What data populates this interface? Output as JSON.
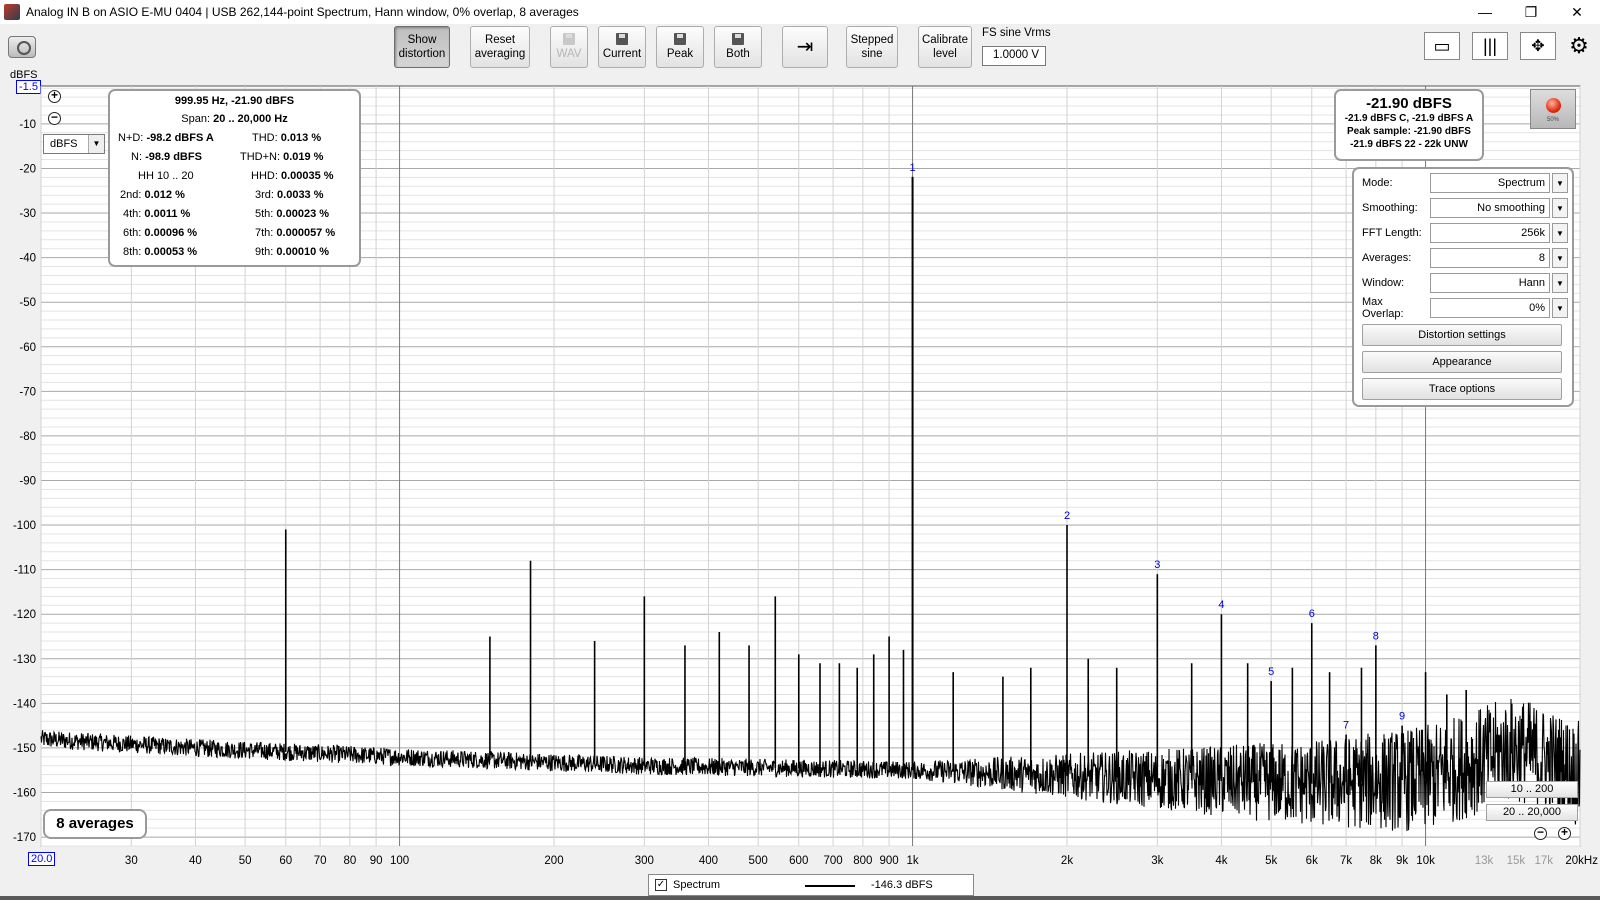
{
  "window": {
    "title": "Analog IN B on ASIO E-MU 0404 | USB 262,144-point Spectrum, Hann window, 0% overlap, 8 averages",
    "controls": [
      "—",
      "❐",
      "✕"
    ]
  },
  "toolbar": {
    "show_distortion": [
      "Show",
      "distortion"
    ],
    "reset_averaging": [
      "Reset",
      "averaging"
    ],
    "wav": "WAV",
    "current": "Current",
    "peak": "Peak",
    "both": "Both",
    "stepped_sine": [
      "Stepped",
      "sine"
    ],
    "calibrate_level": [
      "Calibrate",
      "level"
    ],
    "fs_sine_label": "FS sine Vrms",
    "fs_sine_value": "1.0000 V"
  },
  "axis": {
    "unit_label": "dBFS",
    "top_value_box": "-1.5",
    "left_value_box": "20.0",
    "unit_selected": "dBFS"
  },
  "distortion": {
    "header": "999.95 Hz, -21.90 dBFS",
    "span_label": "Span:",
    "span_value": "20 .. 20,000 Hz",
    "nd_label": "N+D:",
    "nd_value": "-98.2 dBFS A",
    "thd_label": "THD:",
    "thd_value": "0.013 %",
    "n_label": "N:",
    "n_value": "-98.9 dBFS",
    "thdn_label": "THD+N:",
    "thdn_value": "0.019 %",
    "hh_label": "HH 10 .. 20",
    "hhd_label": "HHD:",
    "hhd_value": "0.00035 %",
    "h2_label": "2nd:",
    "h2_value": "0.012 %",
    "h3_label": "3rd:",
    "h3_value": "0.0033 %",
    "h4_label": "4th:",
    "h4_value": "0.0011 %",
    "h5_label": "5th:",
    "h5_value": "0.00023 %",
    "h6_label": "6th:",
    "h6_value": "0.00096 %",
    "h7_label": "7th:",
    "h7_value": "0.000057 %",
    "h8_label": "8th:",
    "h8_value": "0.00053 %",
    "h9_label": "9th:",
    "h9_value": "0.00010 %"
  },
  "level": {
    "main": "-21.90 dBFS",
    "line1": "-21.9 dBFS C, -21.9 dBFS A",
    "line2": "Peak sample: -21.90 dBFS",
    "line3": "-21.9 dBFS 22 - 22k UNW",
    "record_pct": "50%"
  },
  "settings": {
    "mode_label": "Mode:",
    "mode_value": "Spectrum",
    "smoothing_label": "Smoothing:",
    "smoothing_value": "No  smoothing",
    "fft_label": "FFT Length:",
    "fft_value": "256k",
    "averages_label": "Averages:",
    "averages_value": "8",
    "window_label": "Window:",
    "window_value": "Hann",
    "overlap_label": "Max Overlap:",
    "overlap_value": "0%",
    "distortion_settings": "Distortion settings",
    "appearance": "Appearance",
    "trace_options": "Trace options"
  },
  "averages_badge": "8 averages",
  "range_buttons": [
    "10 .. 200",
    "20 .. 20,000"
  ],
  "legend": {
    "checked": "✓",
    "name": "Spectrum",
    "value": "-146.3 dBFS"
  },
  "colors": {
    "trace": "#000000",
    "grid_minor": "#e3e3e3",
    "grid_major": "#a8a8a8",
    "harmonic_label": "#0000cc",
    "value_box": "#0000ff"
  },
  "chart_data": {
    "type": "line",
    "title": "",
    "xlabel": "",
    "ylabel": "dBFS",
    "x_scale": "log",
    "xlim": [
      20,
      20000
    ],
    "ylim": [
      -172,
      -1.5
    ],
    "grid": true,
    "x_tick_values": [
      30,
      40,
      50,
      60,
      70,
      80,
      90,
      100,
      200,
      300,
      400,
      500,
      600,
      700,
      800,
      900,
      1000,
      2000,
      3000,
      4000,
      5000,
      6000,
      7000,
      8000,
      9000,
      10000,
      13000,
      15000,
      17000,
      20000
    ],
    "x_tick_labels": [
      "30",
      "40",
      "50",
      "60",
      "70",
      "80",
      "90",
      "100",
      "200",
      "300",
      "400",
      "500",
      "600",
      "700",
      "800",
      "900",
      "1k",
      "2k",
      "3k",
      "4k",
      "5k",
      "6k",
      "7k",
      "8k",
      "9k",
      "10k",
      "13k",
      "15k",
      "17k",
      "20kHz"
    ],
    "y_tick_values": [
      -10,
      -20,
      -30,
      -40,
      -50,
      -60,
      -70,
      -80,
      -90,
      -100,
      -110,
      -120,
      -130,
      -140,
      -150,
      -160,
      -170
    ],
    "y_tick_labels": [
      "-10",
      "-20",
      "-30",
      "-40",
      "-50",
      "-60",
      "-70",
      "-80",
      "-90",
      "-100",
      "-110",
      "-120",
      "-130",
      "-140",
      "-150",
      "-160",
      "-170"
    ],
    "series": [
      {
        "noise_floor": [
          [
            20,
            -148
          ],
          [
            40,
            -150
          ],
          [
            100,
            -152
          ],
          [
            300,
            -154
          ],
          [
            1000,
            -155
          ],
          [
            3000,
            -157
          ],
          [
            6000,
            -158
          ],
          [
            10000,
            -157
          ],
          [
            15000,
            -150
          ],
          [
            20000,
            -156
          ]
        ],
        "spikes": [
          [
            60,
            -101
          ],
          [
            150,
            -125
          ],
          [
            180,
            -108
          ],
          [
            240,
            -126
          ],
          [
            300,
            -116
          ],
          [
            360,
            -127
          ],
          [
            420,
            -124
          ],
          [
            480,
            -127
          ],
          [
            540,
            -116
          ],
          [
            600,
            -129
          ],
          [
            660,
            -131
          ],
          [
            720,
            -131
          ],
          [
            780,
            -132
          ],
          [
            840,
            -129
          ],
          [
            900,
            -125
          ],
          [
            960,
            -128
          ],
          [
            999.95,
            -21.9
          ],
          [
            1200,
            -133
          ],
          [
            1500,
            -134
          ],
          [
            1700,
            -132
          ],
          [
            2000,
            -100
          ],
          [
            2200,
            -130
          ],
          [
            2500,
            -132
          ],
          [
            3000,
            -111
          ],
          [
            3500,
            -131
          ],
          [
            4000,
            -120
          ],
          [
            4500,
            -131
          ],
          [
            5000,
            -135
          ],
          [
            5500,
            -132
          ],
          [
            6000,
            -122
          ],
          [
            6500,
            -133
          ],
          [
            7000,
            -147
          ],
          [
            7500,
            -132
          ],
          [
            8000,
            -127
          ],
          [
            9000,
            -145
          ],
          [
            10000,
            -133
          ],
          [
            11000,
            -138
          ],
          [
            12000,
            -137
          ]
        ]
      }
    ],
    "harmonic_markers": [
      {
        "label": "1",
        "x": 999.95,
        "y": -21.9
      },
      {
        "label": "2",
        "x": 2000,
        "y": -100
      },
      {
        "label": "3",
        "x": 3000,
        "y": -111
      },
      {
        "label": "4",
        "x": 4000,
        "y": -120
      },
      {
        "label": "5",
        "x": 5000,
        "y": -135
      },
      {
        "label": "6",
        "x": 6000,
        "y": -122
      },
      {
        "label": "7",
        "x": 7000,
        "y": -147
      },
      {
        "label": "8",
        "x": 8000,
        "y": -127
      },
      {
        "label": "9",
        "x": 9000,
        "y": -145
      }
    ]
  }
}
